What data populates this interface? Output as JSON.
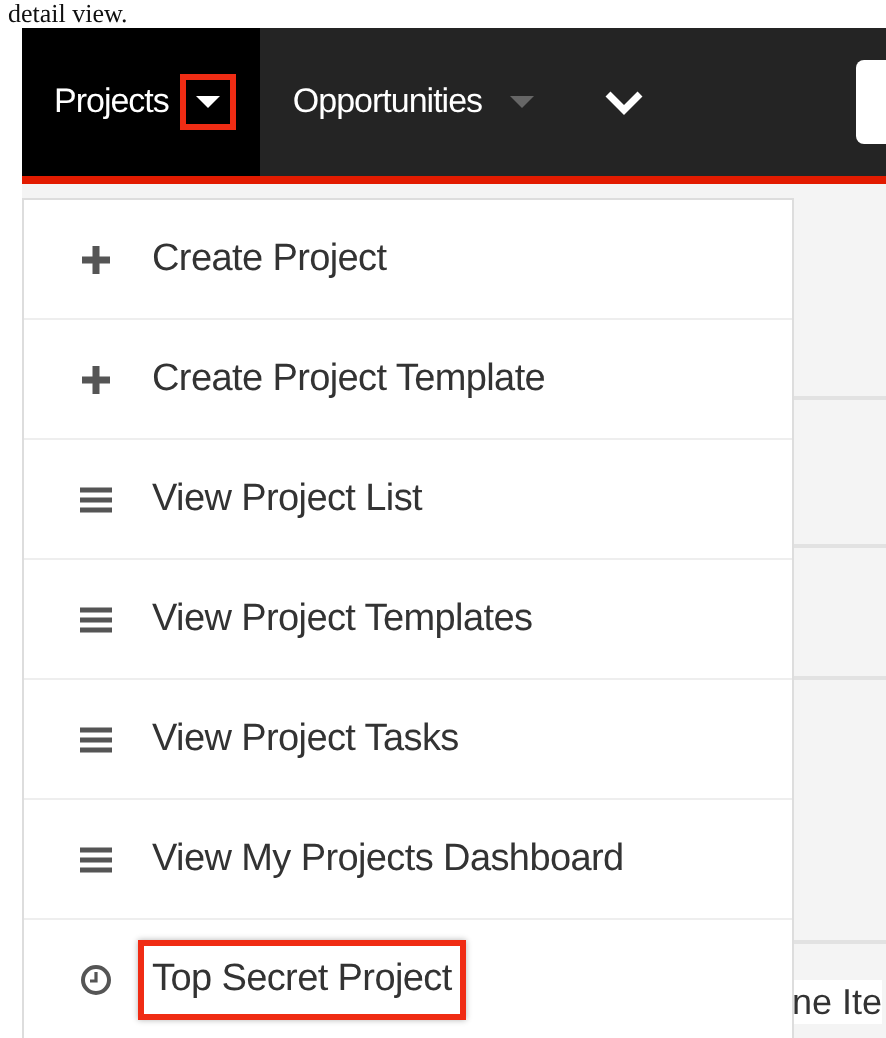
{
  "caption": "detail view.",
  "nav": [
    {
      "label": "Projects",
      "selected": true,
      "caret_highlighted": true
    },
    {
      "label": "Opportunities",
      "selected": false,
      "caret_highlighted": false
    }
  ],
  "dropdown": [
    {
      "kind": "plus",
      "label": "Create Project",
      "highlighted": false
    },
    {
      "kind": "plus",
      "label": "Create Project Template",
      "highlighted": false
    },
    {
      "kind": "list",
      "label": "View Project List",
      "highlighted": false
    },
    {
      "kind": "list",
      "label": "View Project Templates",
      "highlighted": false
    },
    {
      "kind": "list",
      "label": "View Project Tasks",
      "highlighted": false
    },
    {
      "kind": "list",
      "label": "View My Projects Dashboard",
      "highlighted": false
    },
    {
      "kind": "recent",
      "label": "Top Secret Project",
      "highlighted": true
    }
  ],
  "background_text": "ne Ite"
}
